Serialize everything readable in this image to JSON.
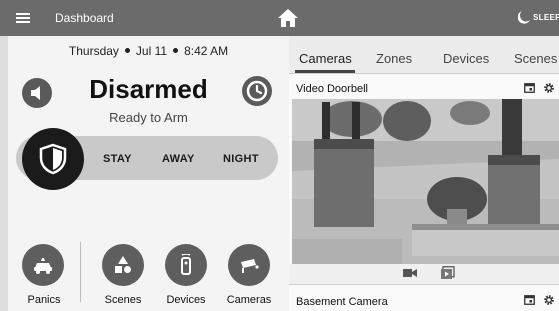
{
  "topbar": {
    "title": "Dashboard",
    "sleep_label": "SLEEP"
  },
  "security": {
    "day": "Thursday",
    "date": "Jul 11",
    "time": "8:42 AM",
    "status": "Disarmed",
    "substatus": "Ready to Arm",
    "modes": [
      "STAY",
      "AWAY",
      "NIGHT"
    ]
  },
  "quick_actions": [
    {
      "label": "Panics",
      "icon": "panic-car-icon"
    },
    {
      "label": "Scenes",
      "icon": "scenes-shapes-icon"
    },
    {
      "label": "Devices",
      "icon": "remote-device-icon"
    },
    {
      "label": "Cameras",
      "icon": "security-camera-icon"
    }
  ],
  "tabs": [
    "Cameras",
    "Zones",
    "Devices",
    "Scenes"
  ],
  "active_tab": "Cameras",
  "cameras": [
    {
      "name": "Video Doorbell"
    },
    {
      "name": "Basement Camera"
    }
  ]
}
